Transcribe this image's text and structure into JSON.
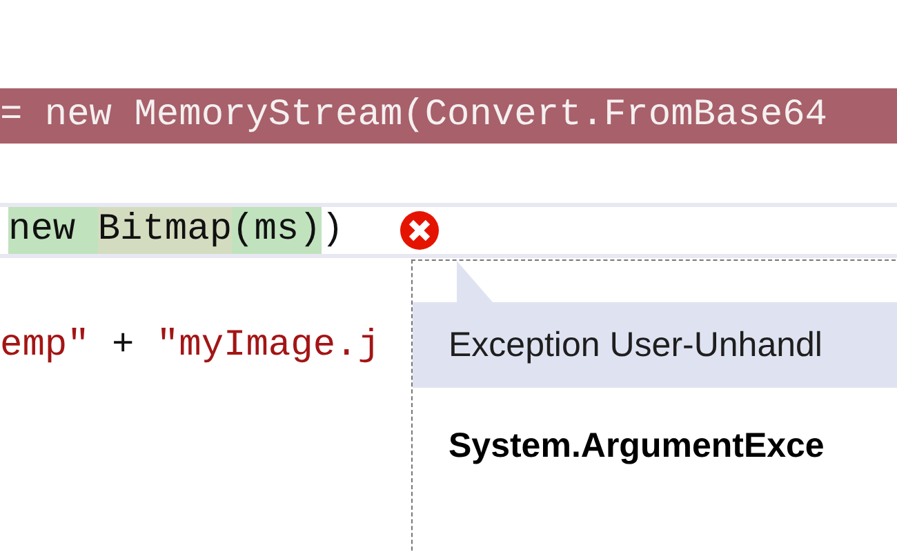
{
  "code_lines": [
    {
      "kind": "error",
      "current": false,
      "segments": [
        {
          "text": "= new MemoryStream(Convert.FromBase64",
          "kind": "plain",
          "highlighted": false,
          "selected": false
        }
      ]
    },
    {
      "kind": "normal",
      "current": true,
      "segments": [
        {
          "text": "new ",
          "kind": "plain",
          "highlighted": true,
          "selected": false
        },
        {
          "text": "Bitmap",
          "kind": "plain",
          "highlighted": true,
          "selected": true
        },
        {
          "text": "(ms)",
          "kind": "plain",
          "highlighted": true,
          "selected": false
        },
        {
          "text": ")",
          "kind": "plain",
          "highlighted": false,
          "selected": false
        }
      ]
    },
    {
      "kind": "normal",
      "current": false,
      "segments": [
        {
          "text": "emp\"",
          "kind": "string",
          "highlighted": false,
          "selected": false
        },
        {
          "text": " + ",
          "kind": "plain",
          "highlighted": false,
          "selected": false
        },
        {
          "text": "\"myImage.j",
          "kind": "string",
          "highlighted": false,
          "selected": false
        }
      ]
    }
  ],
  "popup": {
    "header": "Exception User-Unhandl",
    "exception": "System.ArgumentExce"
  }
}
